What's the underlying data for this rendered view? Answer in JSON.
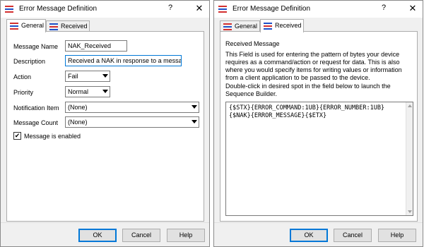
{
  "dialog_left": {
    "title": "Error Message Definition",
    "help": "?",
    "close": "✕",
    "tabs": {
      "general": "General",
      "received": "Received"
    },
    "form": {
      "message_name": {
        "label": "Message Name",
        "value": "NAK_Received"
      },
      "description": {
        "label": "Description",
        "value": "Received a NAK in response to a message"
      },
      "action": {
        "label": "Action",
        "value": "Fail"
      },
      "priority": {
        "label": "Priority",
        "value": "Normal"
      },
      "notification_item": {
        "label": "Notification Item",
        "value": "(None)"
      },
      "message_count": {
        "label": "Message Count",
        "value": "(None)"
      },
      "enabled": {
        "label": "Message is enabled",
        "checked": true,
        "mark": "✔"
      }
    },
    "buttons": {
      "ok": "OK",
      "cancel": "Cancel",
      "help": "Help"
    }
  },
  "dialog_right": {
    "title": "Error Message Definition",
    "help": "?",
    "close": "✕",
    "tabs": {
      "general": "General",
      "received": "Received"
    },
    "received": {
      "heading": "Received Message",
      "description": "This Field is used for entering the pattern of bytes your device requires as a command/action or request for data.  This is also where you would specify items for writing values or information from a client application to be passed to the device.",
      "hint": "Double-click in desired spot in the field below to launch the Sequence Builder.",
      "sequence_lines": [
        "{$STX}{ERROR_COMMAND:1UB}{ERROR_NUMBER:1UB}",
        "{$NAK}{ERROR_MESSAGE}{$ETX}"
      ]
    },
    "buttons": {
      "ok": "OK",
      "cancel": "Cancel",
      "help": "Help"
    }
  },
  "colors": {
    "focus_blue": "#0078d7",
    "dialog_bg": "#f0f0f0",
    "icon_red": "#d32f2f",
    "icon_blue": "#1e50c8"
  }
}
